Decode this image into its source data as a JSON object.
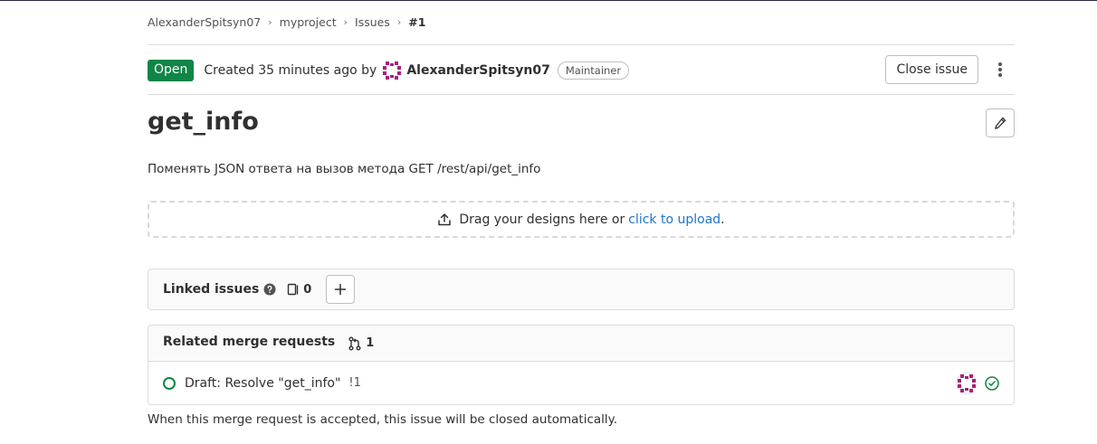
{
  "breadcrumb": {
    "items": [
      "AlexanderSpitsyn07",
      "myproject",
      "Issues"
    ],
    "current": "#1"
  },
  "issue_header": {
    "status": "Open",
    "created_text": "Created 35 minutes ago by",
    "author": "AlexanderSpitsyn07",
    "role": "Maintainer",
    "close_label": "Close issue"
  },
  "issue": {
    "title": "get_info",
    "description": "Поменять JSON ответа на вызов метода GET /rest/api/get_info"
  },
  "dropzone": {
    "text": "Drag your designs here or",
    "link_text": "click to upload",
    "suffix": "."
  },
  "linked_issues": {
    "title": "Linked issues",
    "count": "0"
  },
  "related_mrs": {
    "title": "Related merge requests",
    "count": "1",
    "items": [
      {
        "title": "Draft: Resolve \"get_info\"",
        "ref": "!1",
        "state": "open",
        "pipeline": "success"
      }
    ]
  },
  "closing_note": "When this merge request is accepted, this issue will be closed automatically.",
  "colors": {
    "open_badge": "#108548",
    "link": "#1f75cb",
    "avatar": "#a4237a"
  },
  "icons": {
    "upload": "upload-icon",
    "help": "question-icon",
    "issues": "issues-icon",
    "add": "plus-icon",
    "merge_request": "merge-request-icon",
    "edit": "pencil-icon",
    "more": "ellipsis-v-icon",
    "pipeline_status": "status-success-icon"
  }
}
